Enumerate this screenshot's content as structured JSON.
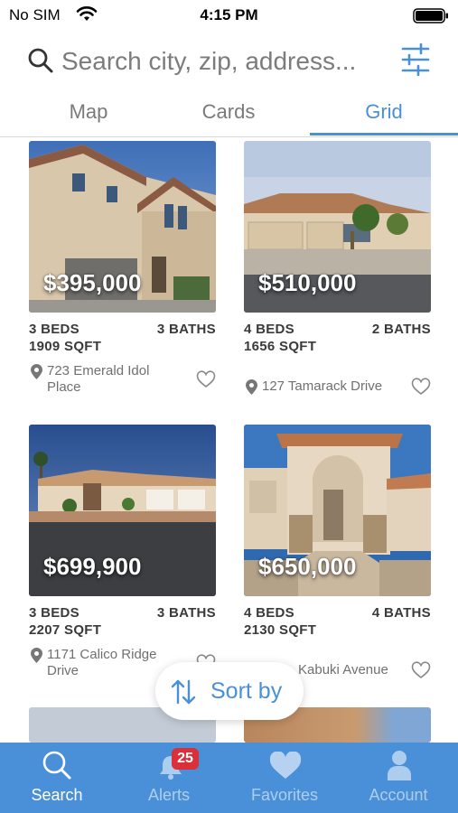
{
  "status_bar": {
    "carrier": "No SIM",
    "time": "4:15 PM"
  },
  "search": {
    "placeholder": "Search city, zip, address...",
    "value": ""
  },
  "icons": {
    "search": "search-icon",
    "filter": "sliders-icon",
    "location": "map-pin-icon",
    "favorite": "heart-outline-icon",
    "sort": "sort-arrows-icon"
  },
  "view_tabs": [
    {
      "label": "Map",
      "active": false
    },
    {
      "label": "Cards",
      "active": false
    },
    {
      "label": "Grid",
      "active": true
    }
  ],
  "listings": [
    {
      "price": "$395,000",
      "beds": "3 BEDS",
      "baths": "3 BATHS",
      "sqft": "1909 SQFT",
      "address": "723 Emerald Idol Place"
    },
    {
      "price": "$510,000",
      "beds": "4 BEDS",
      "baths": "2 BATHS",
      "sqft": "1656 SQFT",
      "address": "127 Tamarack Drive"
    },
    {
      "price": "$699,900",
      "beds": "3 BEDS",
      "baths": "3 BATHS",
      "sqft": "2207 SQFT",
      "address": "1171 Calico Ridge Drive"
    },
    {
      "price": "$650,000",
      "beds": "4 BEDS",
      "baths": "4 BATHS",
      "sqft": "2130 SQFT",
      "address": "Kabuki Avenue"
    }
  ],
  "sort_button": {
    "label": "Sort by"
  },
  "bottom_nav": [
    {
      "label": "Search",
      "icon": "search-icon",
      "active": true
    },
    {
      "label": "Alerts",
      "icon": "bell-icon",
      "active": false,
      "badge": "25"
    },
    {
      "label": "Favorites",
      "icon": "heart-icon",
      "active": false
    },
    {
      "label": "Account",
      "icon": "person-icon",
      "active": false
    }
  ],
  "colors": {
    "accent": "#4a90d9",
    "badge": "#d9303a",
    "tab_bar": "#4a90d9"
  }
}
